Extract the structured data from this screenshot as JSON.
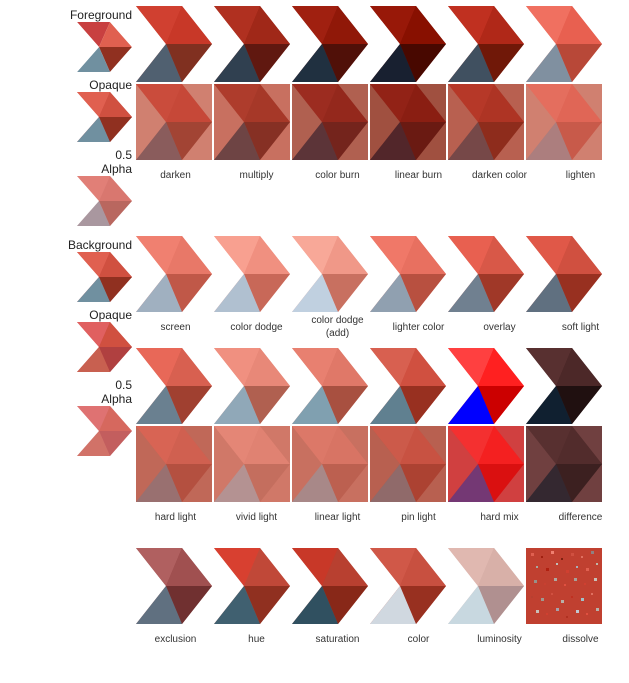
{
  "labels": {
    "foreground": "Foreground",
    "background": "Background",
    "opaque": "Opaque",
    "alpha": "0.5\nAlpha"
  },
  "sections": [
    {
      "id": "section1",
      "rows": [
        {
          "id": "darken-row",
          "cells": [
            {
              "id": "darken",
              "label": "darken",
              "colors": [
                "#c03030",
                "#a02020",
                "#903020",
                "#c05050"
              ]
            },
            {
              "id": "multiply",
              "label": "multiply",
              "colors": [
                "#902010",
                "#800010",
                "#700820",
                "#b04040"
              ]
            },
            {
              "id": "color_burn",
              "label": "color burn",
              "colors": [
                "#701010",
                "#600000",
                "#601020",
                "#904030"
              ]
            },
            {
              "id": "linear_burn",
              "label": "linear burn",
              "colors": [
                "#601010",
                "#500000",
                "#501020",
                "#803030"
              ]
            },
            {
              "id": "darken_color",
              "label": "darken color",
              "colors": [
                "#901010",
                "#800010",
                "#700020",
                "#a04040"
              ]
            },
            {
              "id": "lighten",
              "label": "lighten",
              "colors": [
                "#e06050",
                "#d05040",
                "#c06050",
                "#e08060"
              ]
            }
          ]
        }
      ]
    }
  ],
  "blendModes": [
    [
      "darken",
      "multiply",
      "color burn",
      "linear burn",
      "darken color",
      "lighten"
    ],
    [
      "screen",
      "color dodge",
      "color dodge\n(add)",
      "lighter color",
      "overlay",
      "soft light"
    ],
    [
      "hard light",
      "vivid light",
      "linear light",
      "pin light",
      "hard mix",
      "difference"
    ],
    [
      "exclusion",
      "hue",
      "saturation",
      "color",
      "luminosity",
      "dissolve"
    ]
  ],
  "colors": {
    "accent": "#c03020",
    "bg_light": "#e8d8d0"
  }
}
